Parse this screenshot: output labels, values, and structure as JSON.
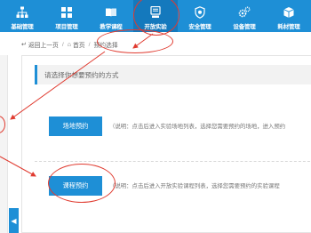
{
  "nav": {
    "items": [
      {
        "label": "基础管理",
        "icon": "sitemap-icon",
        "active": false
      },
      {
        "label": "项目管理",
        "icon": "grid-icon",
        "active": false
      },
      {
        "label": "教学课程",
        "icon": "book-icon",
        "active": false
      },
      {
        "label": "开放实验",
        "icon": "computer-icon",
        "active": true
      },
      {
        "label": "安全管理",
        "icon": "shield-gear-icon",
        "active": false
      },
      {
        "label": "设备管理",
        "icon": "gears-icon",
        "active": false
      },
      {
        "label": "耗材管理",
        "icon": "box-icon",
        "active": false
      }
    ]
  },
  "breadcrumb": {
    "back": "返回上一页",
    "home": "首页",
    "current": "预约选择"
  },
  "main": {
    "prompt": "请选择你想要预约的方式",
    "options": [
      {
        "button": "场地预约",
        "description": "（说明：点击后进入实验场地列表，选择您需要预约的场地，进入预约"
      },
      {
        "button": "课程预约",
        "description": "（说明：点击后进入开放实验课程列表，选择您需要预约的实验课程"
      }
    ]
  },
  "colors": {
    "nav_bg": "#1e8fd6",
    "nav_active": "#1479bd",
    "button_bg": "#1e8fd6",
    "annotation": "#e03b30"
  }
}
